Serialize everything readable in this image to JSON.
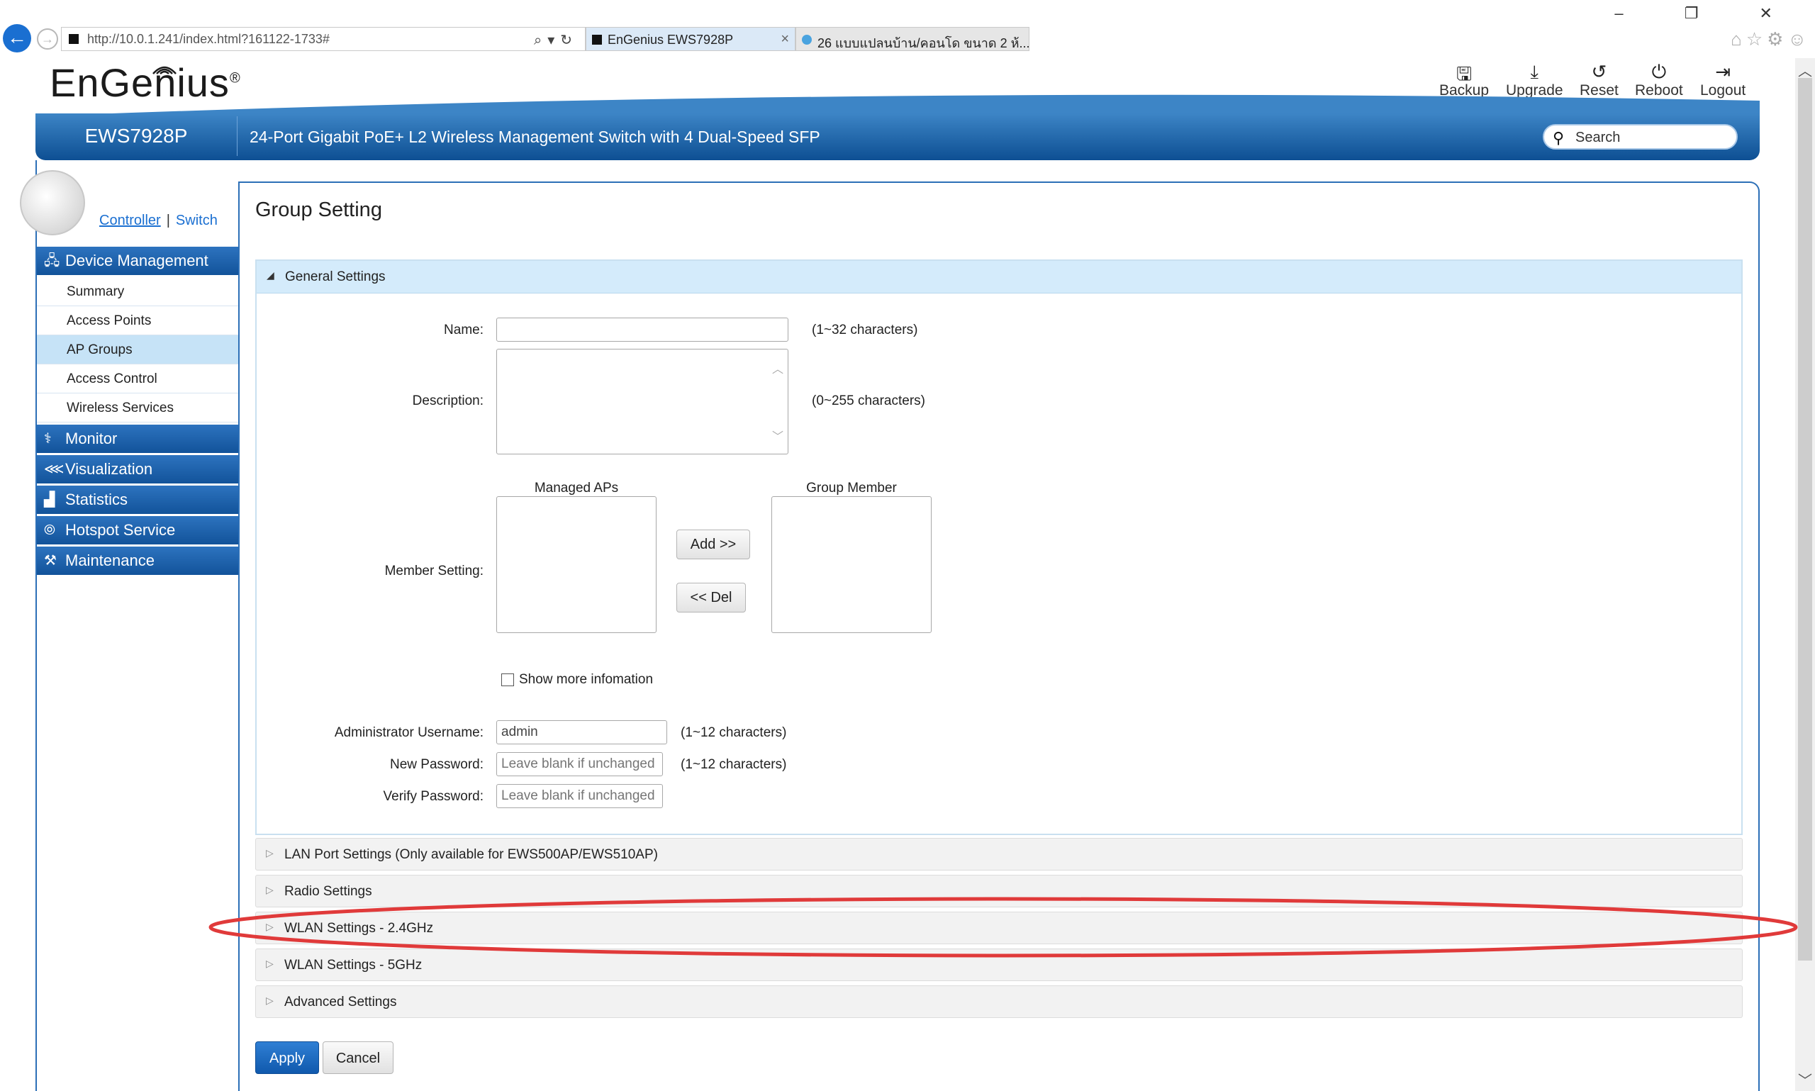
{
  "browser": {
    "url": "http://10.0.1.241/index.html?161122-1733#",
    "tabs": [
      {
        "label": "EnGenius EWS7928P"
      },
      {
        "label": "26 แบบแปลนบ้าน/คอนโด ขนาด 2 ห้..."
      }
    ],
    "tab_close": "×",
    "window_controls": "–  ❐  ✕",
    "right_icons": "⌂☆⚙☺"
  },
  "header": {
    "logo": "EnGenius",
    "logo_mark": "®",
    "toolbar": [
      {
        "label": "Backup",
        "icon": "save-icon"
      },
      {
        "label": "Upgrade",
        "icon": "download-icon"
      },
      {
        "label": "Reset",
        "icon": "reset-icon"
      },
      {
        "label": "Reboot",
        "icon": "power-icon"
      },
      {
        "label": "Logout",
        "icon": "logout-icon"
      }
    ],
    "model": "EWS7928P",
    "model_desc": "24-Port Gigabit PoE+ L2 Wireless Management Switch with 4 Dual-Speed SFP",
    "search_placeholder": "Search"
  },
  "mode": {
    "controller": "Controller",
    "switch": "Switch",
    "separator": "|"
  },
  "sidebar": {
    "device_management": "Device Management",
    "sub_items": [
      "Summary",
      "Access Points",
      "AP Groups",
      "Access Control",
      "Wireless Services"
    ],
    "active_sub": "AP Groups",
    "main_items": [
      "Monitor",
      "Visualization",
      "Statistics",
      "Hotspot Service",
      "Maintenance"
    ]
  },
  "page": {
    "title": "Group Setting",
    "general_settings": "General Settings",
    "fields": {
      "name_label": "Name:",
      "name_hint": "(1~32 characters)",
      "name_value": "",
      "description_label": "Description:",
      "description_hint": "(0~255 characters)",
      "member_label": "Member Setting:",
      "managed_aps": "Managed APs",
      "group_member": "Group Member",
      "add_button": "Add >>",
      "del_button": "<< Del",
      "show_more": "Show more infomation",
      "admin_user_label": "Administrator Username:",
      "admin_user_value": "admin",
      "admin_user_hint": "(1~12 characters)",
      "new_pw_label": "New Password:",
      "new_pw_placeholder": "Leave blank if unchanged",
      "new_pw_hint": "(1~12 characters)",
      "verify_pw_label": "Verify Password:",
      "verify_pw_placeholder": "Leave blank if unchanged"
    },
    "sections": [
      "LAN Port Settings (Only available for EWS500AP/EWS510AP)",
      "Radio Settings",
      "WLAN Settings - 2.4GHz",
      "WLAN Settings - 5GHz",
      "Advanced Settings"
    ],
    "apply": "Apply",
    "cancel": "Cancel"
  },
  "colors": {
    "brand_blue": "#12539a",
    "highlight_red": "#e03a3a",
    "active_row": "#c6e3f7"
  }
}
